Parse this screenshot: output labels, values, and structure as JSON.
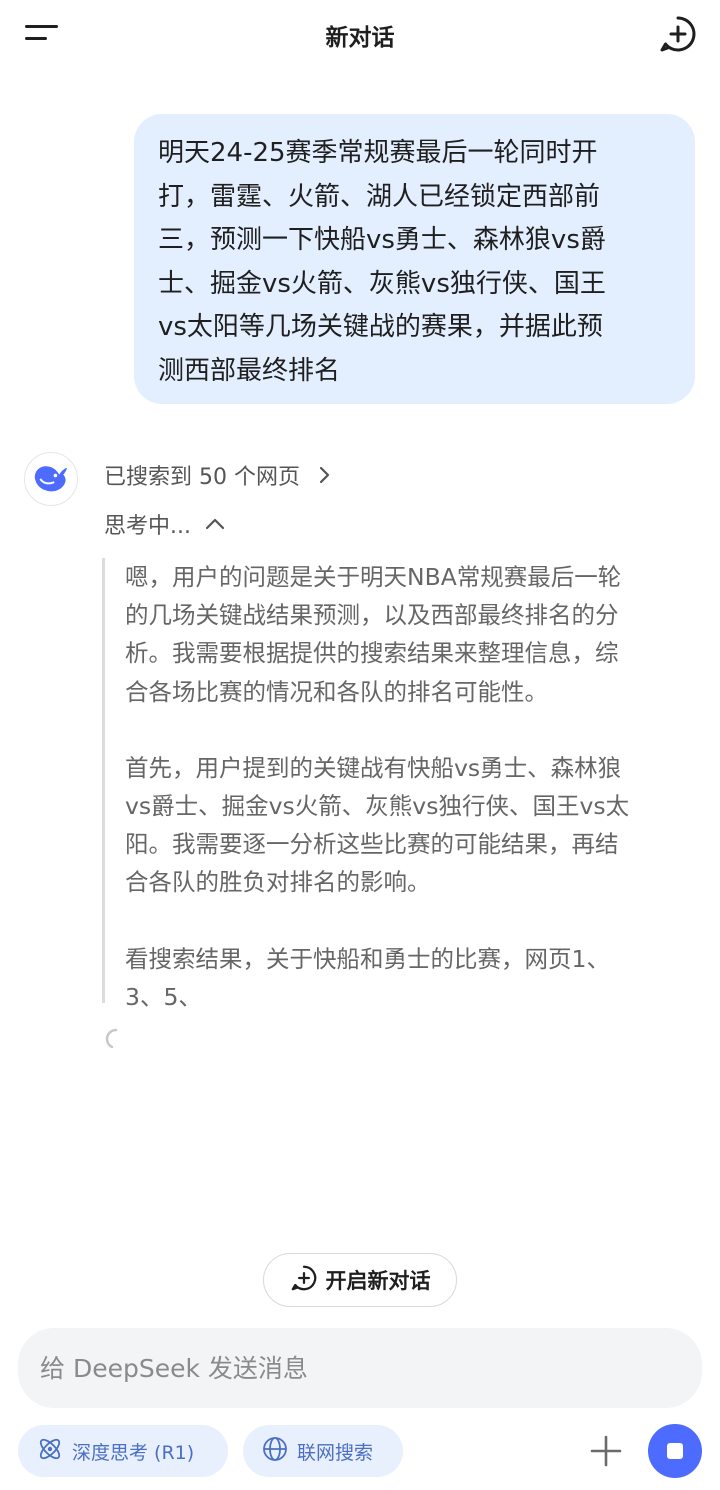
{
  "header": {
    "title": "新对话"
  },
  "user_message": {
    "lines": [
      "明天24-25赛季常规赛最后一轮同时开",
      "打，雷霆、火箭、湖人已经锁定西部前",
      "三，预测一下快船vs勇士、森林狼vs爵",
      "士、掘金vs火箭、灰熊vs独行侠、国王",
      "vs太阳等几场关键战的赛果，并据此预",
      "测西部最终排名"
    ]
  },
  "assistant": {
    "search_status": "已搜索到 50 个网页",
    "thinking_status": "思考中...",
    "thought_paragraphs": [
      [
        "嗯，用户的问题是关于明天NBA常规赛最后一轮",
        "的几场关键战结果预测，以及西部最终排名的分",
        "析。我需要根据提供的搜索结果来整理信息，综",
        "合各场比赛的情况和各队的排名可能性。"
      ],
      [
        "首先，用户提到的关键战有快船vs勇士、森林狼",
        "vs爵士、掘金vs火箭、灰熊vs独行侠、国王vs太",
        "阳。我需要逐一分析这些比赛的可能结果，再结",
        "合各队的胜负对排名的影响。"
      ],
      [
        "看搜索结果，关于快船和勇士的比赛，网页1、",
        "3、5、"
      ]
    ]
  },
  "new_dialog_button": {
    "label": "开启新对话"
  },
  "composer": {
    "placeholder": "给 DeepSeek 发送消息"
  },
  "toolbar": {
    "deep_think_label": "深度思考 (R1)",
    "web_search_label": "联网搜索"
  },
  "colors": {
    "accent": "#4d6bfe",
    "bubble": "#e3effe",
    "pill_bg": "#e9f0fd",
    "pill_text": "#4a6fc5"
  },
  "icons": [
    "menu-icon",
    "new-chat-icon",
    "deepseek-logo-icon",
    "chevron-right-icon",
    "chevron-up-icon",
    "spinner-icon",
    "atom-icon",
    "globe-icon",
    "plus-icon",
    "stop-icon"
  ]
}
